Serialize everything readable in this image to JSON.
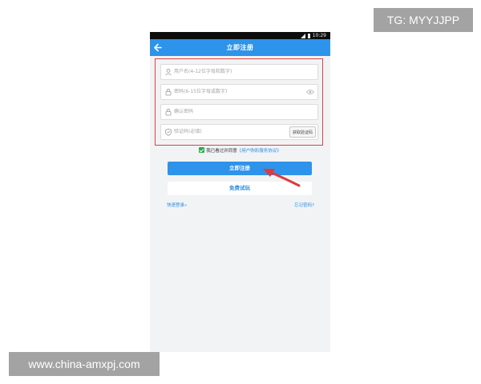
{
  "status_bar": {
    "time": "10:29"
  },
  "app_bar": {
    "title": "立即注册"
  },
  "form": {
    "username_placeholder": "用户名(4-12位字母和数字)",
    "password_placeholder": "密码(6-15位字母或数字)",
    "confirm_placeholder": "确认密码",
    "code_placeholder": "验证码(必填)",
    "get_code_label": "获取验证码"
  },
  "agreement": {
    "checked": true,
    "text": "我已看过并同意",
    "link": "《用户购彩服务协议》"
  },
  "buttons": {
    "register_label": "立即注册",
    "trial_label": "免费试玩"
  },
  "links": {
    "quick_login": "快速登录»",
    "forgot_password": "忘记密码?"
  },
  "watermarks": {
    "top_right": "TG: MYYJJPP",
    "bottom_left": "www.china-amxpj.com"
  },
  "colors": {
    "primary": "#2e93ea",
    "highlight_box": "#d94545",
    "checkbox": "#2ea84f"
  },
  "icons": [
    "back-arrow-icon",
    "user-icon",
    "lock-icon",
    "eye-icon",
    "shield-icon",
    "wifi-icon",
    "battery-icon"
  ]
}
